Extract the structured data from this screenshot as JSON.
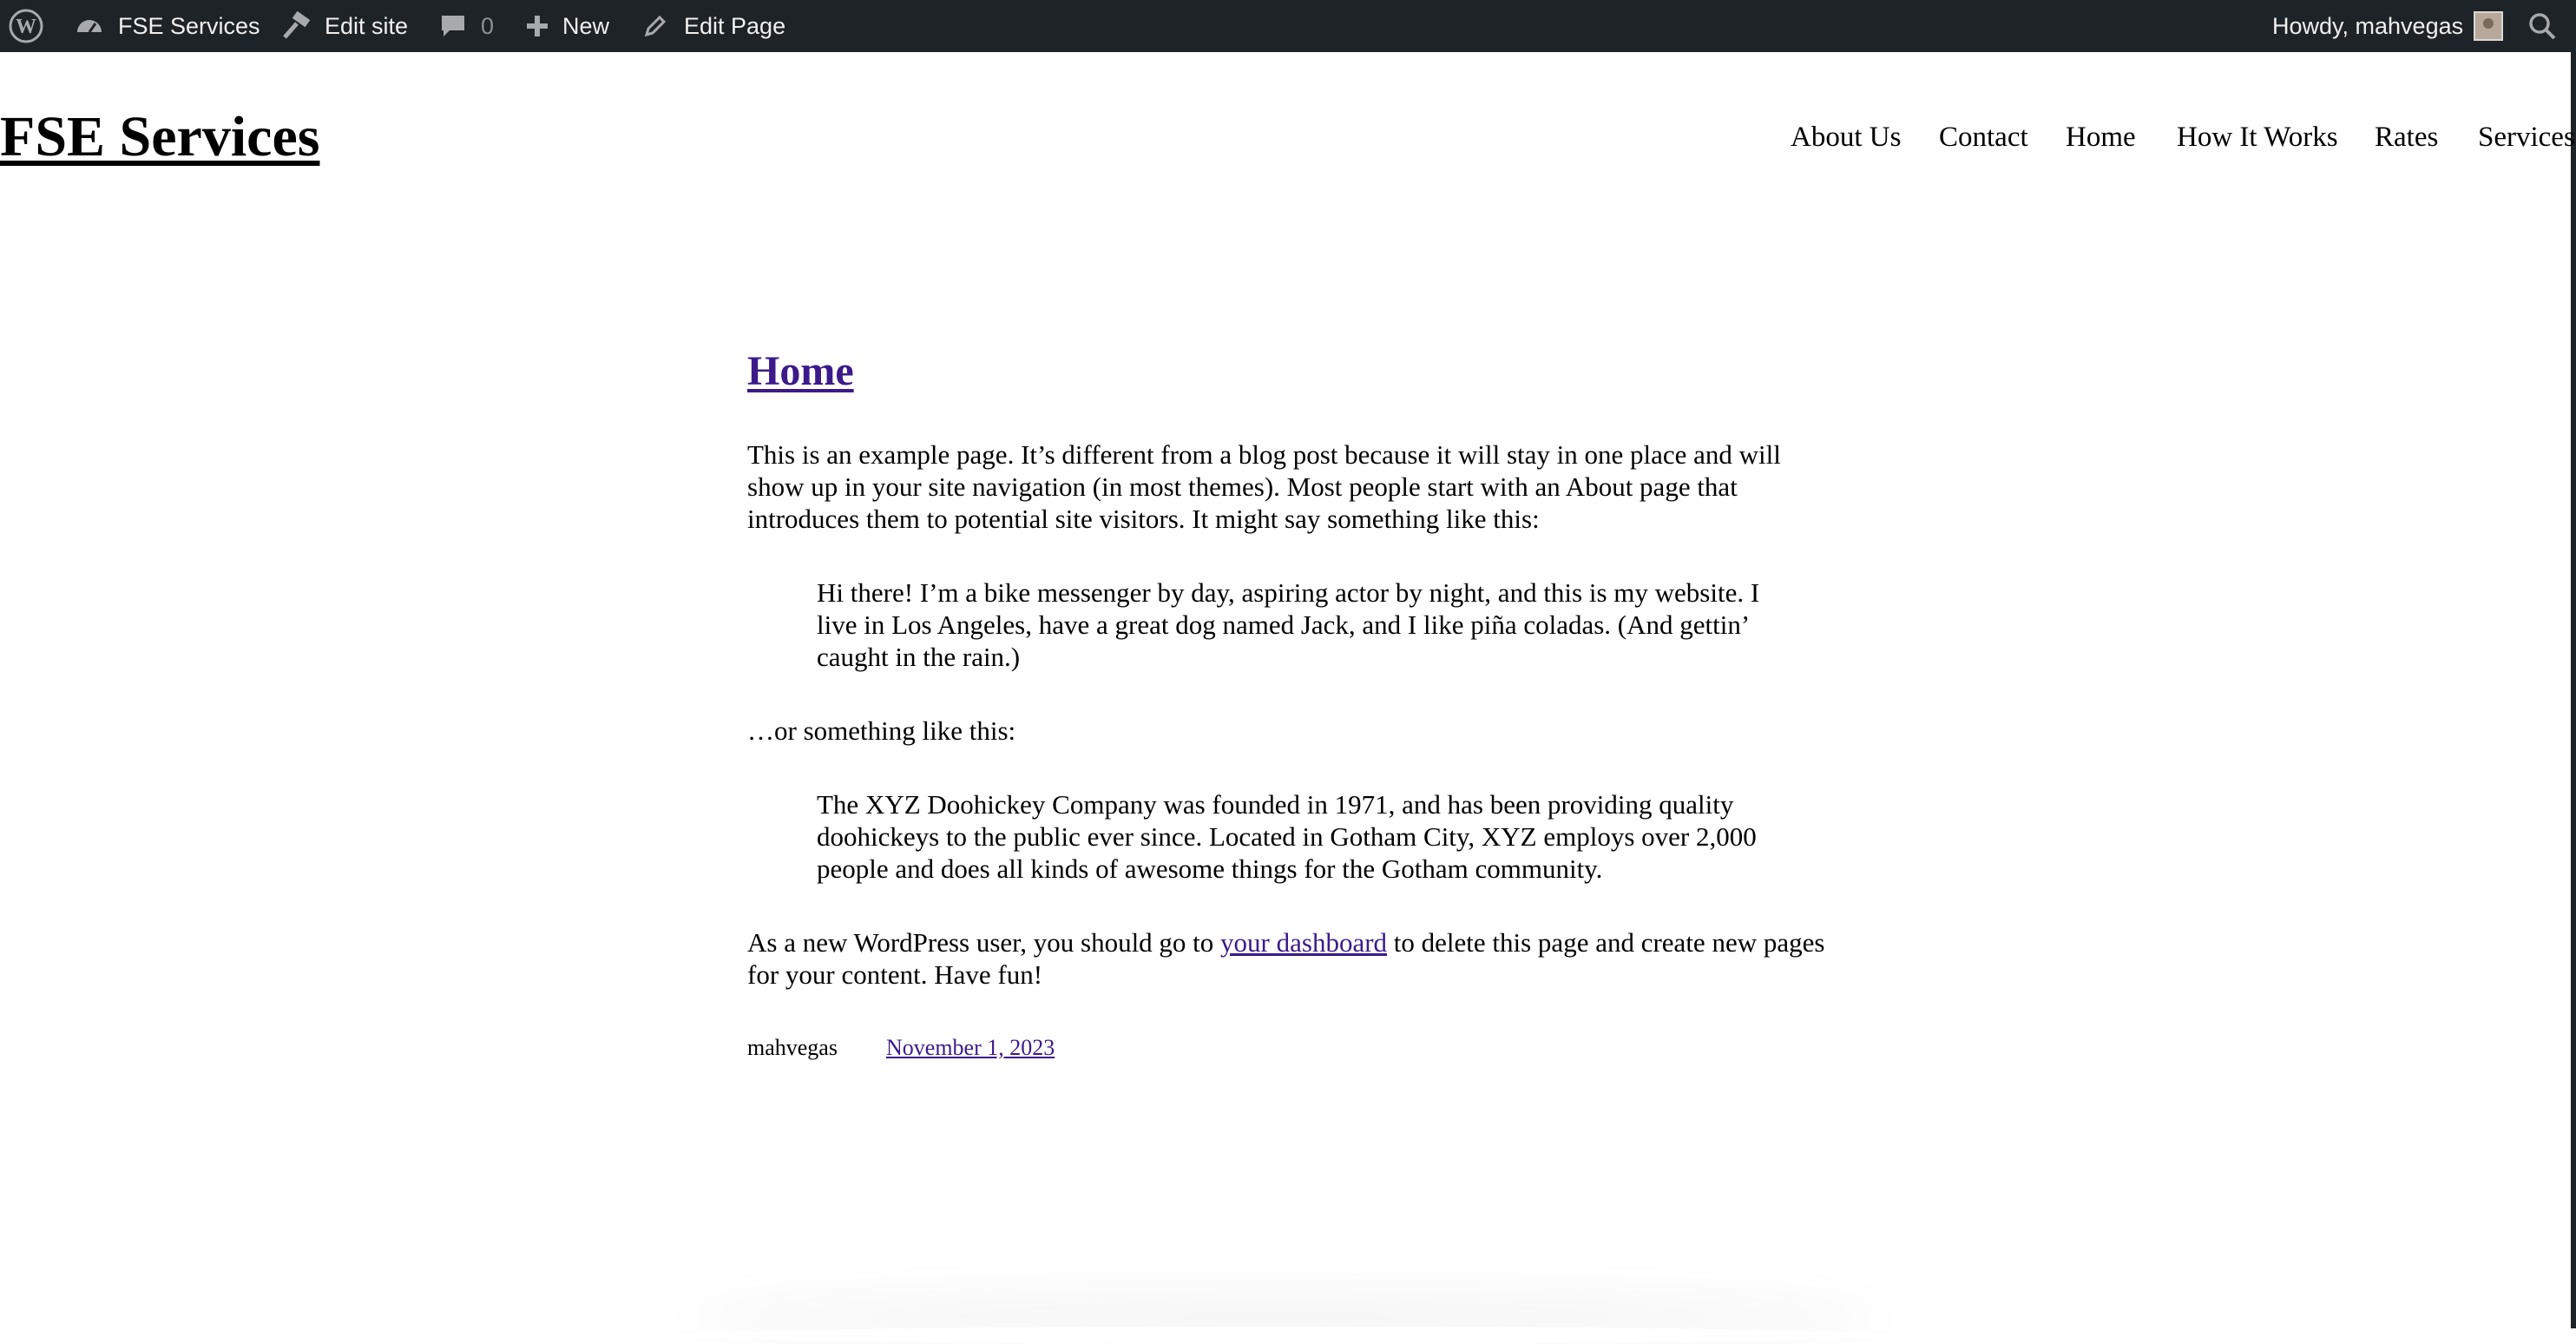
{
  "adminbar": {
    "site_name": "FSE Services",
    "edit_site": "Edit site",
    "comments_count": "0",
    "new": "New",
    "edit_page": "Edit Page",
    "howdy": "Howdy, mahvegas"
  },
  "header": {
    "site_title": "FSE Services",
    "nav": [
      "About Us",
      "Contact",
      "Home",
      "How It Works",
      "Rates",
      "Services"
    ]
  },
  "post": {
    "title": "Home",
    "p1": "This is an example page. It’s different from a blog post because it will stay in one place and will show up in your site navigation (in most themes). Most people start with an About page that introduces them to potential site visitors. It might say something like this:",
    "quote1": "Hi there! I’m a bike messenger by day, aspiring actor by night, and this is my website. I live in Los Angeles, have a great dog named Jack, and I like piña coladas. (And gettin’ caught in the rain.)",
    "p2": "…or something like this:",
    "quote2": "The XYZ Doohickey Company was founded in 1971, and has been providing quality doohickeys to the public ever since. Located in Gotham City, XYZ employs over 2,000 people and does all kinds of awesome things for the Gotham community.",
    "p3_before": "As a new WordPress user, you should go to",
    "p3_link": "your dashboard",
    "p3_after": "to delete this page and create new pages for your content. Have fun!",
    "author": "mahvegas",
    "date": "November 1, 2023"
  },
  "colors": {
    "adminbar_bg": "#1d2327",
    "link": "#3c1a8a"
  }
}
